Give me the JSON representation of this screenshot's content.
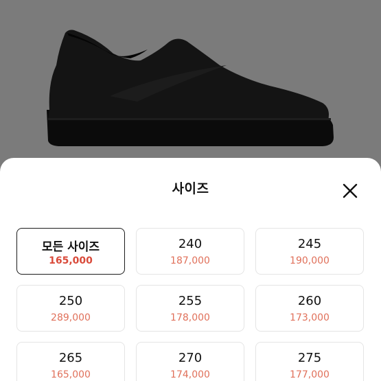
{
  "sheet": {
    "title": "사이즈"
  },
  "sizes": [
    {
      "size": "모든 사이즈",
      "price": "165,000",
      "selected": true
    },
    {
      "size": "240",
      "price": "187,000",
      "selected": false
    },
    {
      "size": "245",
      "price": "190,000",
      "selected": false
    },
    {
      "size": "250",
      "price": "289,000",
      "selected": false
    },
    {
      "size": "255",
      "price": "178,000",
      "selected": false
    },
    {
      "size": "260",
      "price": "173,000",
      "selected": false
    },
    {
      "size": "265",
      "price": "165,000",
      "selected": false
    },
    {
      "size": "270",
      "price": "174,000",
      "selected": false
    },
    {
      "size": "275",
      "price": "177,000",
      "selected": false
    }
  ],
  "colors": {
    "price": "#e0705a",
    "selected_border": "#1a1a1a",
    "backdrop": "#7b7b7b"
  },
  "icons": {
    "close": "close-icon"
  }
}
